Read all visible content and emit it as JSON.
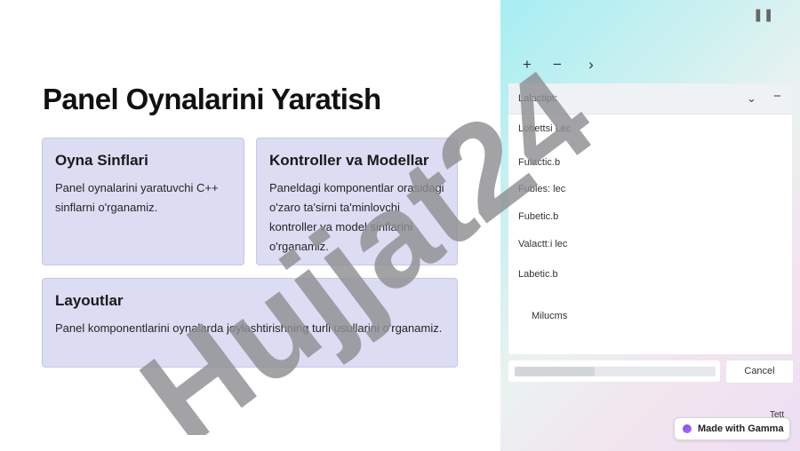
{
  "slide": {
    "title": "Panel Oynalarini Yaratish",
    "cards": [
      {
        "heading": "Oyna Sinflari",
        "text": "Panel oynalarini yaratuvchi C++ sinflarni o'rganamiz."
      },
      {
        "heading": "Kontroller va Modellar",
        "text": "Paneldagi komponentlar orasidagi o'zaro ta'sirni ta'minlovchi kontroller va model sinflarini o'rganamiz."
      },
      {
        "heading": "Layoutlar",
        "text": "Panel komponentlarini oynalarda joylashtirishning turli usullarini o'rganamiz."
      }
    ],
    "watermark": "Hujjat24"
  },
  "panel": {
    "pause_icon": "pause-icon",
    "toolbar": {
      "add": "+",
      "remove": "−",
      "next": "›"
    },
    "list": {
      "header_label": "Lalactipt:",
      "items": [
        "Lobettsi Lec",
        "Fulactic.b",
        "Fubles: lec",
        "Fubetic.b",
        "Valacttːi lec",
        "Labetic.b",
        "Milucms"
      ]
    },
    "progress": 0.4,
    "cancel_label": "Cancel",
    "note": "Tett"
  },
  "badge": {
    "label": "Made with Gamma"
  },
  "colors": {
    "card_bg": "#dcdcf3",
    "watermark_gray": "#8f8f93",
    "watermark_purple": "#c8bff3"
  }
}
